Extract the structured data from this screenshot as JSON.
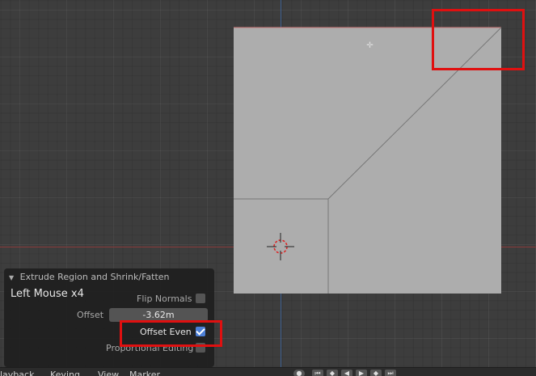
{
  "operator_panel": {
    "title": "Extrude Region and Shrink/Fatten",
    "last_action": "Left Mouse x4",
    "flip_normals_label": "Flip Normals",
    "flip_normals_checked": false,
    "offset_label": "Offset",
    "offset_value": "-3.62m",
    "offset_even_label": "Offset Even",
    "offset_even_checked": true,
    "proportional_editing_label": "Proportional Editing",
    "proportional_editing_checked": false
  },
  "timeline_menu": {
    "playback": "layback",
    "keying": "Keying",
    "view": "View",
    "marker": "Marker"
  },
  "colors": {
    "viewport_bg": "#3d3d3d",
    "mesh_face": "#adadad",
    "highlight": "#e01010",
    "checkbox_on": "#4c7fd6"
  }
}
